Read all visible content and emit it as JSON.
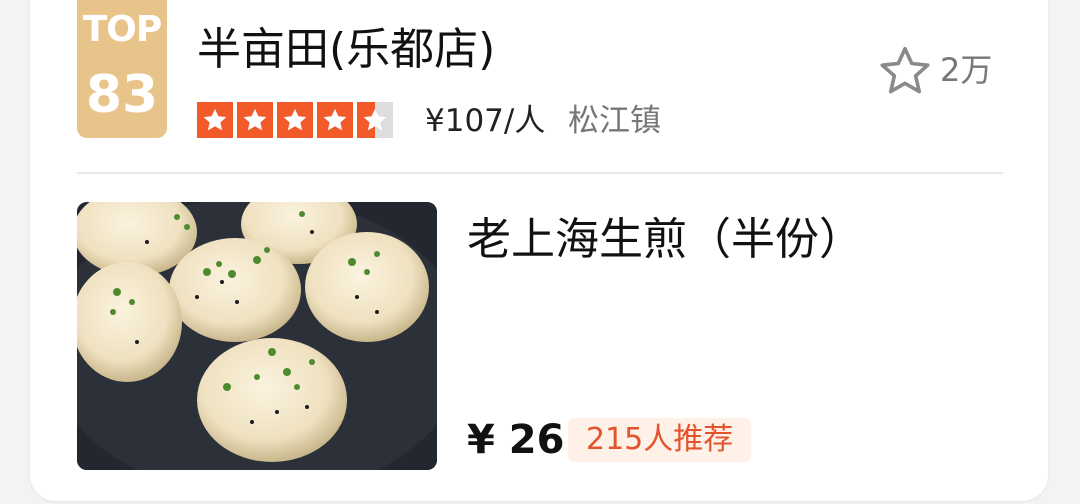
{
  "rank": {
    "label": "TOP",
    "number": "83",
    "badge_color": "#e8c38a"
  },
  "shop": {
    "name": "半亩田(乐都店)",
    "rating_stars": 4.5,
    "price_per_person": "¥107/人",
    "area": "松江镇"
  },
  "favorite": {
    "icon": "star-outline-icon",
    "count": "2万"
  },
  "dish": {
    "name": "老上海生煎（半份）",
    "price": "¥ 26",
    "recommend": "215人推荐",
    "photo": "pan-fried-buns-photo"
  },
  "colors": {
    "star_fill": "#f25a2a",
    "recommend_text": "#e3542c",
    "recommend_bg": "#fff0e8"
  }
}
